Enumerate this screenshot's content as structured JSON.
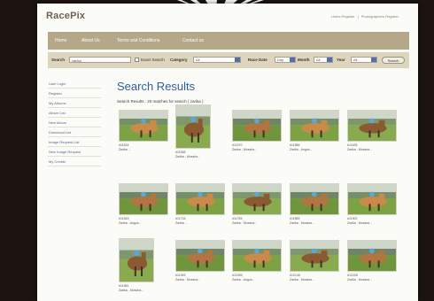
{
  "site": {
    "logo": "RacePix",
    "tagline": "",
    "top_links": [
      "Users Register",
      "|",
      "Photographers Register"
    ]
  },
  "nav": {
    "items": [
      "Home",
      "About Us",
      "Terms and Conditions",
      "Contact us"
    ]
  },
  "search": {
    "field_label": "Search",
    "field_value": "zarika",
    "exact_label": "Exact Search",
    "category_label": "Category",
    "category_value": "All",
    "race_date_label": "Race Date",
    "day_value": "Day",
    "month_label": "Month",
    "month_value": "All",
    "year_label": "Year",
    "year_value": "All",
    "button_label": "Search"
  },
  "sidebar": {
    "items": [
      "User Login",
      "Register",
      "My Albums",
      "Album List",
      "New Album",
      "Download List",
      "Image Request List",
      "New Image Request",
      "My Credits"
    ]
  },
  "main": {
    "title": "Search Results",
    "subtitle": "Search Results : 20 matches for search ( zarika )"
  },
  "thumbs": [
    {
      "ref": "#11524",
      "caption": "Zarika ..."
    },
    {
      "ref": "#11538",
      "caption": "Zarika - Mossha..."
    },
    {
      "ref": "#11570",
      "caption": "Zarika - Mossha..."
    },
    {
      "ref": "#11586",
      "caption": "Zarika - Angus..."
    },
    {
      "ref": "#11628",
      "caption": "Zarika - Mossha..."
    },
    {
      "ref": "#11645",
      "caption": "Zarika - Angus..."
    },
    {
      "ref": "#11716",
      "caption": "Zarika ..."
    },
    {
      "ref": "#11765",
      "caption": "Zarika - Mossha..."
    },
    {
      "ref": "#11885",
      "caption": "Zarika - Mossha..."
    },
    {
      "ref": "#11902",
      "caption": "Zarika - Mossha..."
    },
    {
      "ref": "#11951",
      "caption": "Zarika - Mossha..."
    },
    {
      "ref": "#11993",
      "caption": "Zarika - Mossha..."
    },
    {
      "ref": "#12050",
      "caption": "Zarika - Angus..."
    },
    {
      "ref": "#12146",
      "caption": "Zarika - Mossha..."
    },
    {
      "ref": "#12208",
      "caption": "Zarika - Mossha..."
    }
  ],
  "colors": {
    "nav_bg": "#b5a88a",
    "search_bg": "#ddd5be",
    "title_blue": "#2f5f9b",
    "backdrop": "#1c1410"
  }
}
